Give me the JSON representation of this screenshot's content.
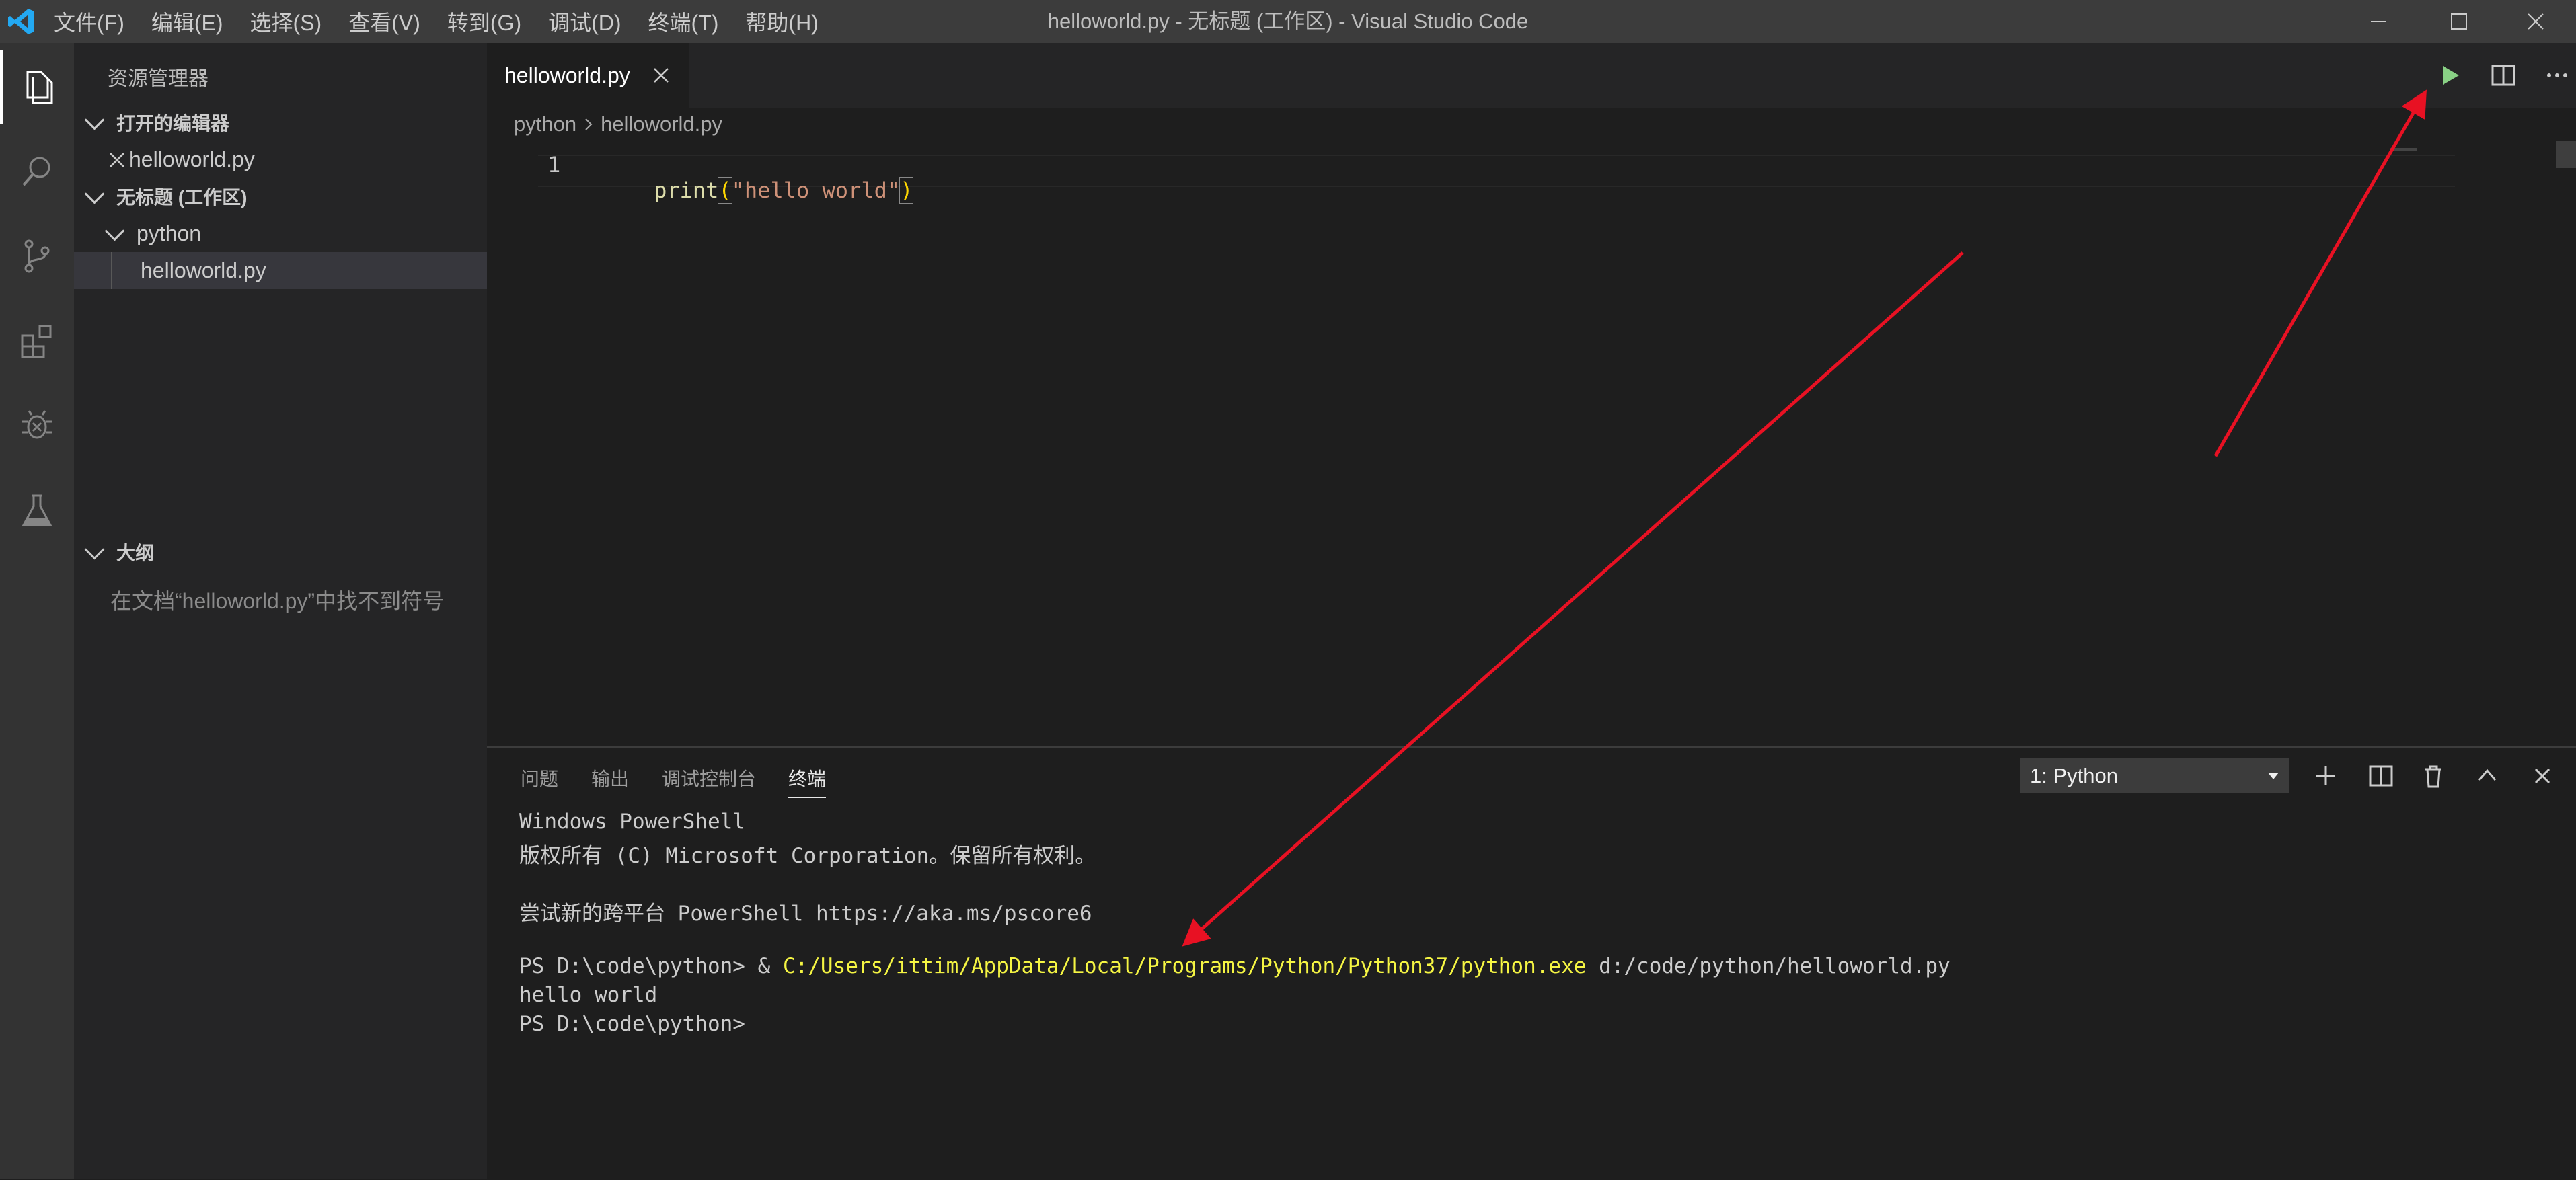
{
  "app": {
    "window_title": "helloworld.py - 无标题 (工作区) - Visual Studio Code",
    "menu": [
      "文件(F)",
      "编辑(E)",
      "选择(S)",
      "查看(V)",
      "转到(G)",
      "调试(D)",
      "终端(T)",
      "帮助(H)"
    ]
  },
  "sidebar": {
    "title": "资源管理器",
    "open_editors_header": "打开的编辑器",
    "open_editor_file": "helloworld.py",
    "workspace_header": "无标题 (工作区)",
    "folder": "python",
    "file": "helloworld.py",
    "outline_header": "大纲",
    "outline_message": "在文档“helloworld.py”中找不到符号"
  },
  "editor": {
    "tab_label": "helloworld.py",
    "breadcrumb": [
      "python",
      "helloworld.py"
    ],
    "line_number": "1",
    "code": {
      "func": "print",
      "open_paren": "(",
      "string": "\"hello world\"",
      "close_paren": ")"
    }
  },
  "panel": {
    "tabs": [
      "问题",
      "输出",
      "调试控制台",
      "终端"
    ],
    "active_tab_index": 3,
    "terminal_select": "1: Python",
    "terminal": {
      "line1": "Windows PowerShell",
      "line2": "版权所有 (C) Microsoft Corporation。保留所有权利。",
      "line3": "尝试新的跨平台 PowerShell https://aka.ms/pscore6",
      "prompt_prefix": "PS D:\\code\\python> & ",
      "exe_path": "C:/Users/ittim/AppData/Local/Programs/Python/Python37/python.exe",
      "script_arg": " d:/code/python/helloworld.py",
      "output": "hello world",
      "final_prompt": "PS D:\\code\\python>"
    }
  },
  "colors": {
    "run_button": "#89d185",
    "annotation_arrow": "#e81123",
    "terminal_path": "#f5f543",
    "string": "#ce9178",
    "function": "#dcdcaa"
  }
}
